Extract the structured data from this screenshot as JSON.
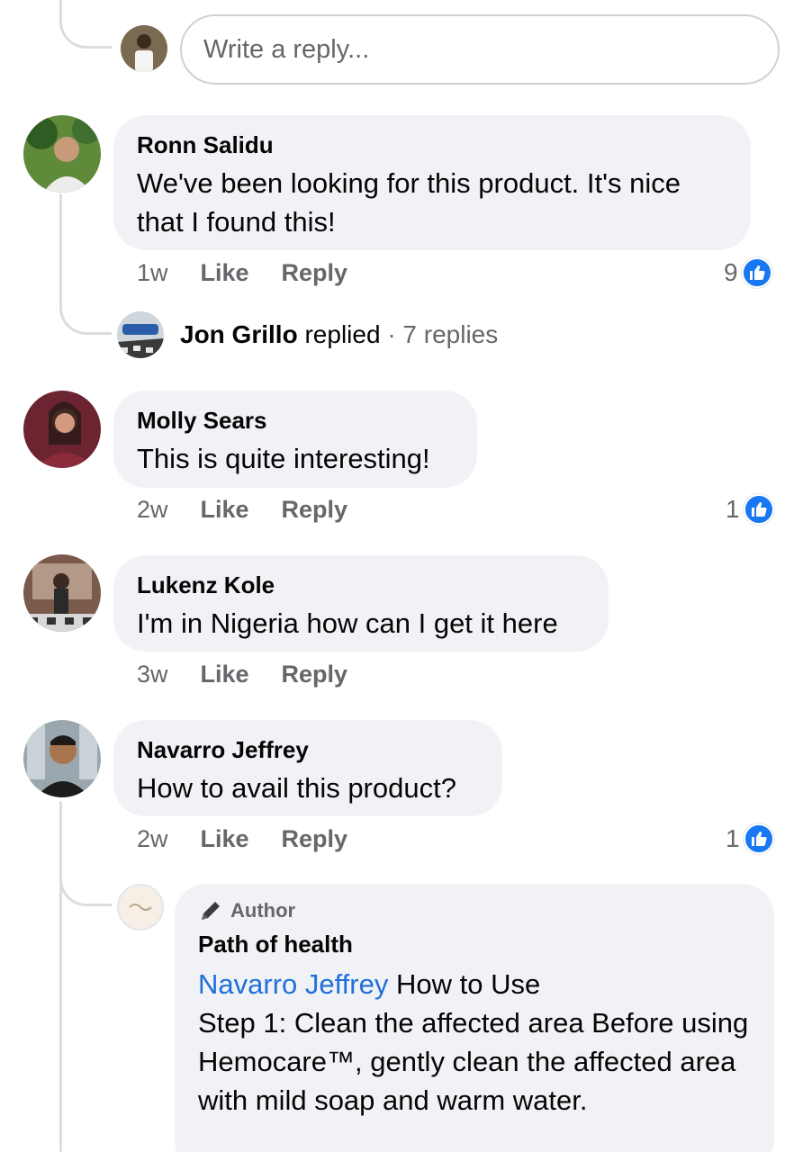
{
  "reply_box": {
    "placeholder": "Write a reply..."
  },
  "comments": [
    {
      "author": "Ronn Salidu",
      "text": "We've been looking for this product. It's nice that I found this!",
      "time": "1w",
      "like_label": "Like",
      "reply_label": "Reply",
      "reactions": "9"
    },
    {
      "author": "Molly Sears",
      "text": "This is quite interesting!",
      "time": "2w",
      "like_label": "Like",
      "reply_label": "Reply",
      "reactions": "1"
    },
    {
      "author": "Lukenz Kole",
      "text": "I'm in Nigeria how can I get it here",
      "time": "3w",
      "like_label": "Like",
      "reply_label": "Reply"
    },
    {
      "author": "Navarro Jeffrey",
      "text": "How to avail this product?",
      "time": "2w",
      "like_label": "Like",
      "reply_label": "Reply",
      "reactions": "1"
    }
  ],
  "replied_summary": {
    "name": "Jon Grillo",
    "verb": "replied",
    "separator": "·",
    "count": "7 replies"
  },
  "author_reply": {
    "badge": "Author",
    "name": "Path of health",
    "mention": "Navarro Jeffrey",
    "text_first": "How to Use",
    "text_rest": "Step 1: Clean the affected area Before using Hemocare™, gently clean the affected area with mild soap and warm water."
  },
  "colors": {
    "bubble": "#f0f2f5",
    "like_blue": "#1877f2",
    "muted": "#65676b",
    "mention": "#216fdb"
  },
  "icons": [
    "like-thumb-icon",
    "pencil-icon"
  ]
}
